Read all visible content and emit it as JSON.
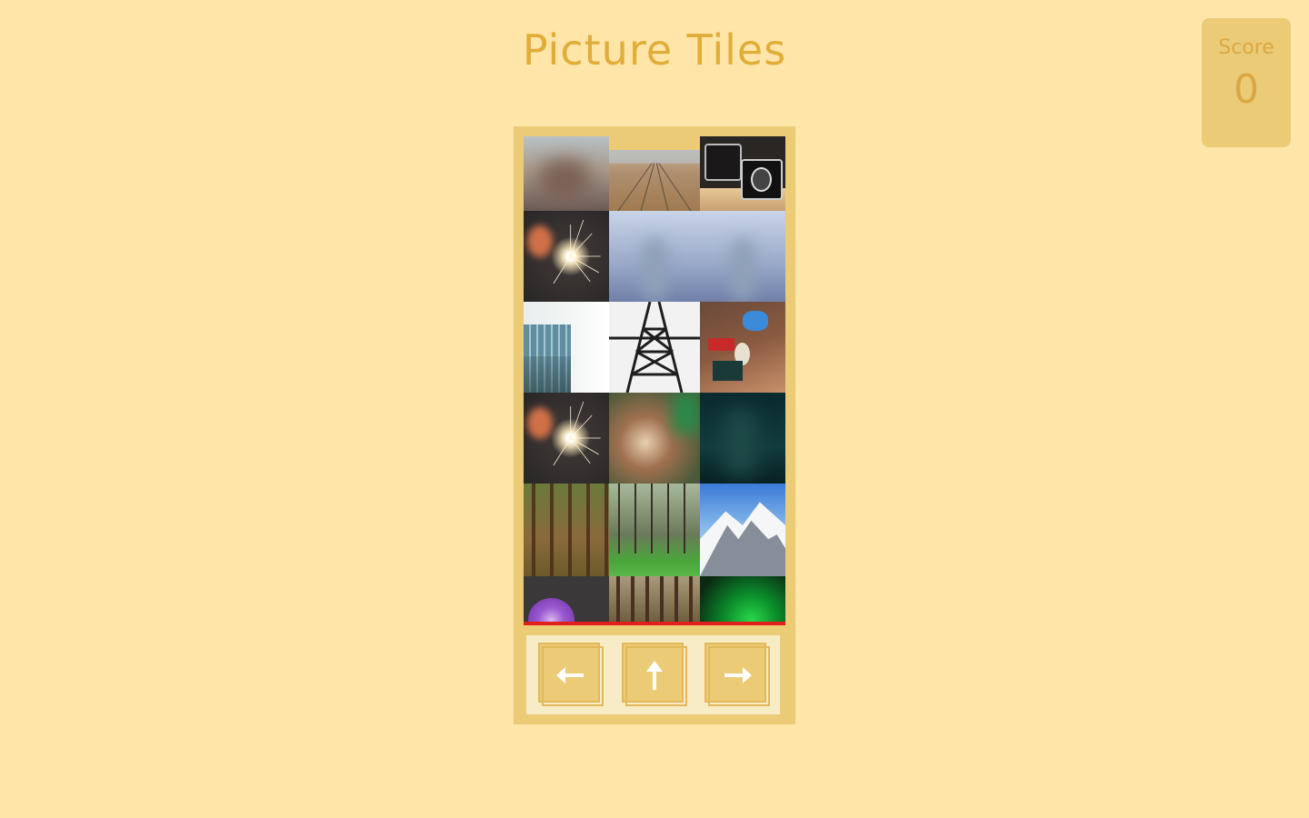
{
  "title": "Picture Tiles",
  "score": {
    "label": "Score",
    "value": "0"
  },
  "colors": {
    "background": "#ffe5a8",
    "board": "#eccb77",
    "title": "#e0ad38",
    "danger_line": "#e0201a",
    "controls_panel": "#f8ecc7"
  },
  "columns": [
    {
      "name": "left",
      "tiles": [
        "blurred-dusk",
        "sparkler",
        "glass-building",
        "sparkler",
        "pine-forest",
        "purple-flower"
      ]
    },
    {
      "name": "middle",
      "tiles": [
        "railway-tracks",
        "blurred-blue",
        "steel-tower",
        "blurred-green-brown",
        "forest-green-grass",
        "forest-trunks"
      ]
    },
    {
      "name": "right",
      "tiles": [
        "vintage-cameras",
        "blurred-blue",
        "desk-stickers",
        "blurred-teal",
        "snowy-mountains",
        "green-glow"
      ]
    }
  ],
  "controls": [
    {
      "name": "move-left",
      "icon": "arrow-left-icon"
    },
    {
      "name": "drop",
      "icon": "arrow-up-icon"
    },
    {
      "name": "move-right",
      "icon": "arrow-right-icon"
    }
  ]
}
